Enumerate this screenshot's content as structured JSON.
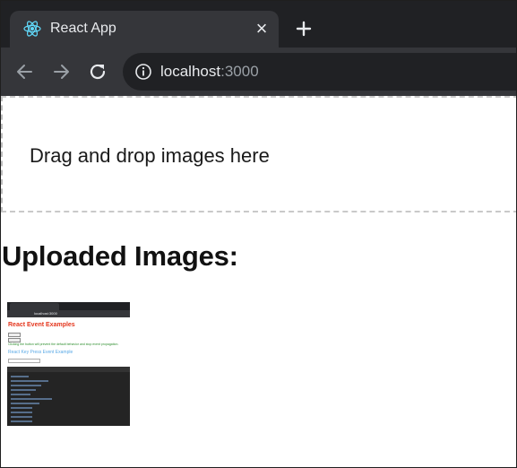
{
  "browser": {
    "tab": {
      "title": "React App",
      "favicon": "react-logo-icon",
      "close": "×"
    },
    "new_tab": "+",
    "nav": {
      "back": "arrow-left-icon",
      "forward": "arrow-right-icon",
      "reload": "reload-icon"
    },
    "address": {
      "icon": "info-icon",
      "host": "localhost",
      "port": ":3000"
    },
    "colors": {
      "tabstrip": "#202124",
      "toolbar": "#35363a",
      "text": "#e8eaed",
      "muted": "#9aa0a6"
    }
  },
  "page": {
    "dropzone_text": "Drag and drop images here",
    "uploaded_heading": "Uploaded Images:"
  },
  "thumbnail": {
    "tab_label": "React App",
    "url": "localhost:3000",
    "heading": "React Event Examples",
    "buttons": [
      "Click Me",
      "Click Me"
    ],
    "note": "Clicking the button will prevent the default behavior and stop event propagation.",
    "subheading": "React Key Press Event Example",
    "input_placeholder": "Key"
  }
}
